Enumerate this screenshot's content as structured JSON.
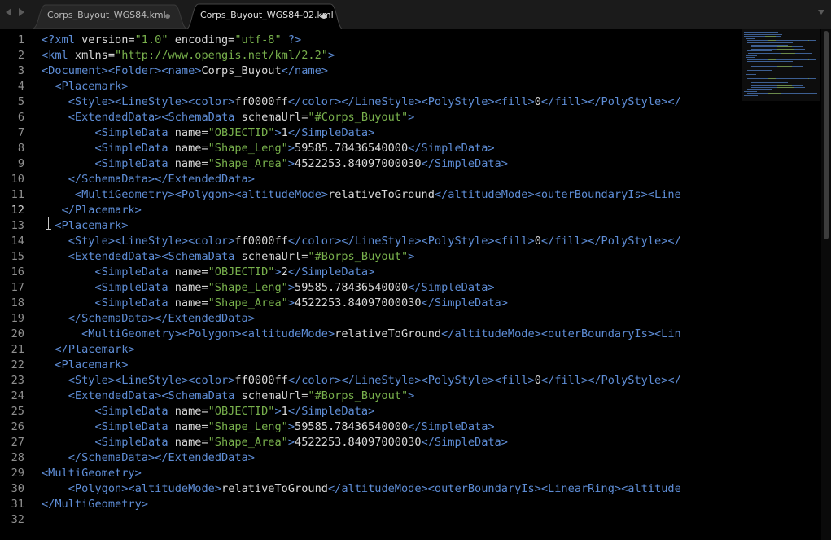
{
  "tabs": [
    {
      "label": "Corps_Buyout_WGS84.kml",
      "active": false
    },
    {
      "label": "Corps_Buyout_WGS84-02.kml",
      "active": true
    }
  ],
  "icons": {
    "back": "chevron-left-icon",
    "forward": "chevron-right-icon",
    "tab_modified": "dot-icon",
    "tab_list": "chevron-down-icon"
  },
  "colors": {
    "background": "#000000",
    "tag": "#5e8dd6",
    "string": "#78b04c",
    "text": "#d8d8d8",
    "line_number": "#8f8f8f"
  },
  "editor": {
    "cursor_line": 12,
    "line_numbers": [
      "1",
      "2",
      "3",
      "4",
      "5",
      "6",
      "7",
      "8",
      "9",
      "10",
      "11",
      "12",
      "13",
      "14",
      "15",
      "16",
      "17",
      "18",
      "19",
      "20",
      "21",
      "22",
      "23",
      "24",
      "25",
      "26",
      "27",
      "28",
      "29",
      "30",
      "31",
      "32"
    ],
    "lines": [
      "<?xml version=\"1.0\" encoding=\"utf-8\" ?>",
      "<kml xmlns=\"http://www.opengis.net/kml/2.2\">",
      "<Document><Folder><name>Corps_Buyout</name>",
      "  <Placemark>",
      "    <Style><LineStyle><color>ff0000ff</color></LineStyle><PolyStyle><fill>0</fill></PolyStyle></",
      "    <ExtendedData><SchemaData schemaUrl=\"#Corps_Buyout\">",
      "        <SimpleData name=\"OBJECTID\">1</SimpleData>",
      "        <SimpleData name=\"Shape_Leng\">59585.78436540000</SimpleData>",
      "        <SimpleData name=\"Shape_Area\">4522253.84097000030</SimpleData>",
      "    </SchemaData></ExtendedData>",
      "     <MultiGeometry><Polygon><altitudeMode>relativeToGround</altitudeMode><outerBoundaryIs><Line",
      "   </Placemark>",
      "  <Placemark>",
      "    <Style><LineStyle><color>ff0000ff</color></LineStyle><PolyStyle><fill>0</fill></PolyStyle></",
      "    <ExtendedData><SchemaData schemaUrl=\"#Borps_Buyout\">",
      "        <SimpleData name=\"OBJECTID\">2</SimpleData>",
      "        <SimpleData name=\"Shape_Leng\">59585.78436540000</SimpleData>",
      "        <SimpleData name=\"Shape_Area\">4522253.84097000030</SimpleData>",
      "    </SchemaData></ExtendedData>",
      "      <MultiGeometry><Polygon><altitudeMode>relativeToGround</altitudeMode><outerBoundaryIs><Lin",
      "  </Placemark>",
      "  <Placemark>",
      "    <Style><LineStyle><color>ff0000ff</color></LineStyle><PolyStyle><fill>0</fill></PolyStyle></",
      "    <ExtendedData><SchemaData schemaUrl=\"#Borps_Buyout\">",
      "        <SimpleData name=\"OBJECTID\">1</SimpleData>",
      "        <SimpleData name=\"Shape_Leng\">59585.78436540000</SimpleData>",
      "        <SimpleData name=\"Shape_Area\">4522253.84097000030</SimpleData>",
      "    </SchemaData></ExtendedData>",
      "<MultiGeometry>",
      "    <Polygon><altitudeMode>relativeToGround</altitudeMode><outerBoundaryIs><LinearRing><altitude",
      "</MultiGeometry>",
      ""
    ]
  }
}
